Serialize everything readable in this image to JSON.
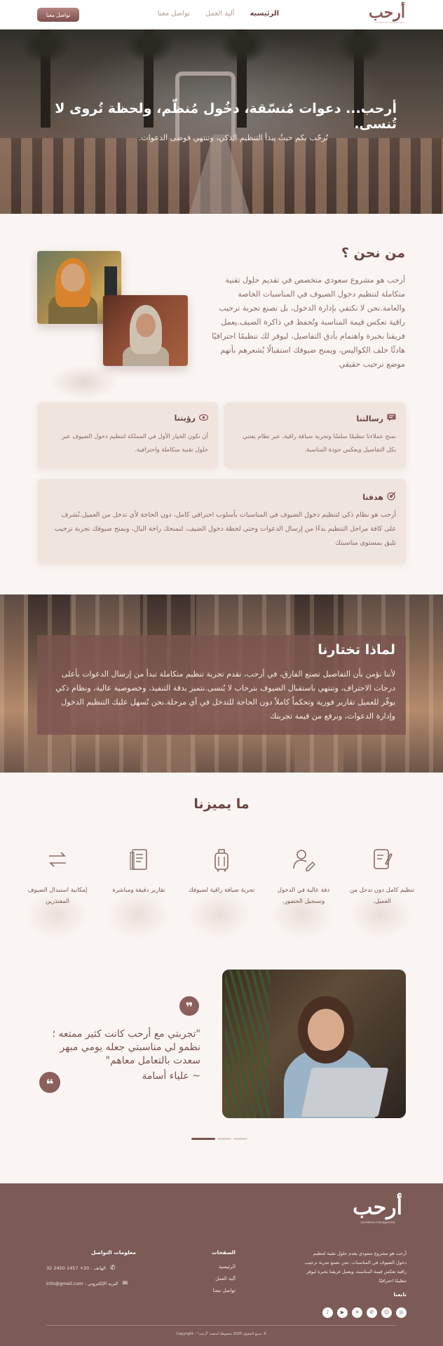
{
  "colors": {
    "brand": "#7c5a56",
    "accent": "#8a5a58",
    "background": "#faf5f2",
    "card": "#efe4de"
  },
  "header": {
    "logo": "أرحب",
    "logo_sub": "excellence management",
    "nav": [
      "الرئيسية",
      "آلية العمل",
      "تواصل معنا"
    ],
    "cta": "تواصل معنا"
  },
  "hero": {
    "title": "أرحب... دعوات مُنسّقة، دخُول مُنظّم، ولحظة تُروى لا تُنسى.",
    "subtitle": "نُرحّب بكم حيثُ يبدأ التنظيم الذكي، وتنتهي فوضى الدعوات."
  },
  "about": {
    "title": "من نحن ؟",
    "text": "أرحب هو مشروع سعودي متخصص في تقديم حلول تقنية متكاملة لتنظيم دخول الضيوف في المناسبات الخاصة والعامة.نحن لا نكتفي بإدارة الدخول، بل نصنع تجربة ترحيب راقية تعكس قيمة المناسبة وتُحفظ في ذاكرة الضيف.يعمل فريقنا بخبرة واهتمام بأدق التفاصيل، ليوفر لك تنظيمًا احترافيًا هادئًا خلف الكواليس، ويمنح ضيوفك استقبالًا يُشعرهم بأنهم موضع ترحيب حقيقي"
  },
  "cards": {
    "mission": {
      "icon": "message-icon",
      "title": "رسالتنا",
      "text": "نمنح عملاءنا تنظيمًا سلسًا وتجربة ضيافة راقية، عبر نظام يعتني بكل التفاصيل ويعكس جودة المناسبة."
    },
    "vision": {
      "icon": "eye-icon",
      "title": "رؤيتنا",
      "text": "أن نكون الخيار الأول في المملكة لتنظيم دخول الضيوف عبر حلول تقنية متكاملة واحترافية."
    },
    "goal": {
      "icon": "target-icon",
      "title": "هدفنا",
      "text": "أرحب هو نظام ذكي لتنظيم دخول الضيوف في المناسبات بأسلوب احترافي كامل، دون الحاجة لأي تدخل من العميل.نُشرف على كافة مراحل التنظيم بدءًا من إرسال الدعوات وحتى لحظة دخول الضيف، لنمنحك راحة البال، ونمنح ضيوفك تجربة ترحيب تليق بمستوى مناسبتك"
    }
  },
  "why": {
    "title": "لماذا تختارنا",
    "text": "لأننا نؤمن بأن التفاصيل تصنع الفارق، في أرحب، نقدم تجربة تنظيم متكاملة تبدأ من إرسال الدعوات بأعلى درجات الاحتراف، وتنتهي باستقبال الضيوف بترحاب لا يُنسى.نتميز بدقة التنفيذ، وخصوصية عالية، ونظام ذكي يوفّر للعميل تقارير فورية وتحكماً كاملاً دون الحاجة للتدخل في أي مرحلة.نحن نُسهل عليك التنظيم الدخول وإدارة الدعوات، ونرفع من قيمة تجربتك"
  },
  "features": {
    "title": "ما يميزنا",
    "items": [
      {
        "icon": "notebook-icon",
        "label": "تنظيم كامل دون تدخل من العميل."
      },
      {
        "icon": "user-edit-icon",
        "label": "دقة عالية في الدخول وتسجيل الحضور."
      },
      {
        "icon": "luggage-icon",
        "label": "تجربة ضيافة راقية لضيوفك"
      },
      {
        "icon": "report-icon",
        "label": "تقارير دقيقة ومباشرة"
      },
      {
        "icon": "swap-icon",
        "label": "إمكانية استبدال الضيوف المعتذرين"
      }
    ]
  },
  "testimonial": {
    "quote": "\"تجربتي مع أرحب كانت كثير ممتعه ؛ نظمو  لي مناسبتي  جعله يومي مبهر سعدت بالتعامل معاهم\"",
    "author": "~ علياء أسامة"
  },
  "footer": {
    "logo": "أرحب",
    "logo_sub": "excellence management",
    "description": "أرحب هو مشروع سعودي يقدم حلول تقنية لتنظيم دخول الضيوف في المناسبات. نحن نصنع تجربة ترحيب راقية تعكس قيمة المناسبة، ويعمل فريقنا بخبرة ليوفر تنظيمًا احترافيًا.",
    "follow_title": "تابعنا",
    "socials": [
      "instagram-icon",
      "snapchat-icon",
      "whatsapp-icon",
      "x-icon",
      "youtube-icon",
      "tiktok-icon"
    ],
    "pages_title": "الصفحات",
    "pages": [
      "الرئيسية",
      "آلية العمل",
      "تواصل معنا"
    ],
    "contact_title": "معلومات التواصل",
    "phone": "الهاتف : 20+ 1457 2450 32",
    "email": "البريد الإلكتروني : info@gmail.com",
    "copyright": "© جميع الحقوق 2025 محفوظة لمنصة \"أرحب\" - Copyright"
  }
}
